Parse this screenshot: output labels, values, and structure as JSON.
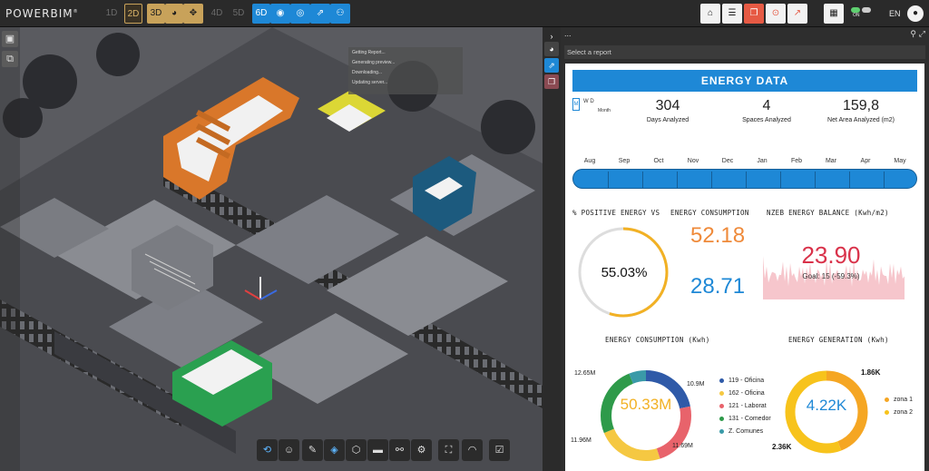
{
  "app": {
    "logo": "POWERBIM",
    "logo_mark": "®"
  },
  "toolbar": {
    "dims": [
      "1D",
      "2D",
      "3D",
      "4D",
      "5D",
      "6D"
    ],
    "language": "EN",
    "toggle_label": "ON"
  },
  "viewport": {
    "notifications": [
      "Getting Report...",
      "Generating preview...",
      "Downloading...",
      "Updating server..."
    ]
  },
  "panel": {
    "select_placeholder": "Select a report",
    "menu_glyph": "..."
  },
  "report": {
    "banner": "ENERGY DATA",
    "period": {
      "m": "M",
      "wd": "W   D",
      "month": "Month"
    },
    "kpis": [
      {
        "value": "304",
        "label": "Days Analyzed"
      },
      {
        "value": "4",
        "label": "Spaces Analyzed"
      },
      {
        "value": "159,8",
        "label": "Net Area Analyzed (m2)"
      }
    ],
    "months": [
      "Aug",
      "Sep",
      "Oct",
      "Nov",
      "Dec",
      "Jan",
      "Feb",
      "Mar",
      "Apr",
      "May"
    ],
    "positive_energy": {
      "title": "% POSITIVE ENERGY VS",
      "value": "55.03%",
      "fraction": 0.5503
    },
    "energy_consumption_kpi": {
      "title": "ENERGY CONSUMPTION",
      "value_top": "52.18",
      "value_bottom": "28.71"
    },
    "nzeb": {
      "title": "NZEB ENERGY BALANCE (Kwh/m2)",
      "value": "23.90",
      "goal": "Goal: 15 (-59.3%)"
    },
    "consumption_donut": {
      "title": "ENERGY CONSUMPTION (Kwh)",
      "center": "50.33M",
      "segments": [
        {
          "name": "119 - Oficina",
          "value": 10.9,
          "label": "10.9M",
          "color": "#2f5aa8"
        },
        {
          "name": "121 - Laborat",
          "value": 11.69,
          "label": "11.69M",
          "color": "#e8636b"
        },
        {
          "name": "162 - Oficina",
          "value": 11.96,
          "label": "11.96M",
          "color": "#f5c842"
        },
        {
          "name": "131 - Comedor",
          "value": 12.65,
          "label": "12.65M",
          "color": "#2e9a4a"
        },
        {
          "name": "Z. Comunes",
          "value": 3.13,
          "label": "",
          "color": "#3a9aa8"
        }
      ],
      "legend_order": [
        "119 - Oficina",
        "162 - Oficina",
        "121 - Laborat",
        "131 - Comedor",
        "Z. Comunes"
      ]
    },
    "generation_donut": {
      "title": "ENERGY GENERATION (Kwh)",
      "center": "4.22K",
      "segments": [
        {
          "name": "zona 1",
          "value": 1.86,
          "label": "1.86K",
          "color": "#f5a623"
        },
        {
          "name": "zona 2",
          "value": 2.36,
          "label": "2.36K",
          "color": "#f7c31c"
        }
      ]
    }
  }
}
